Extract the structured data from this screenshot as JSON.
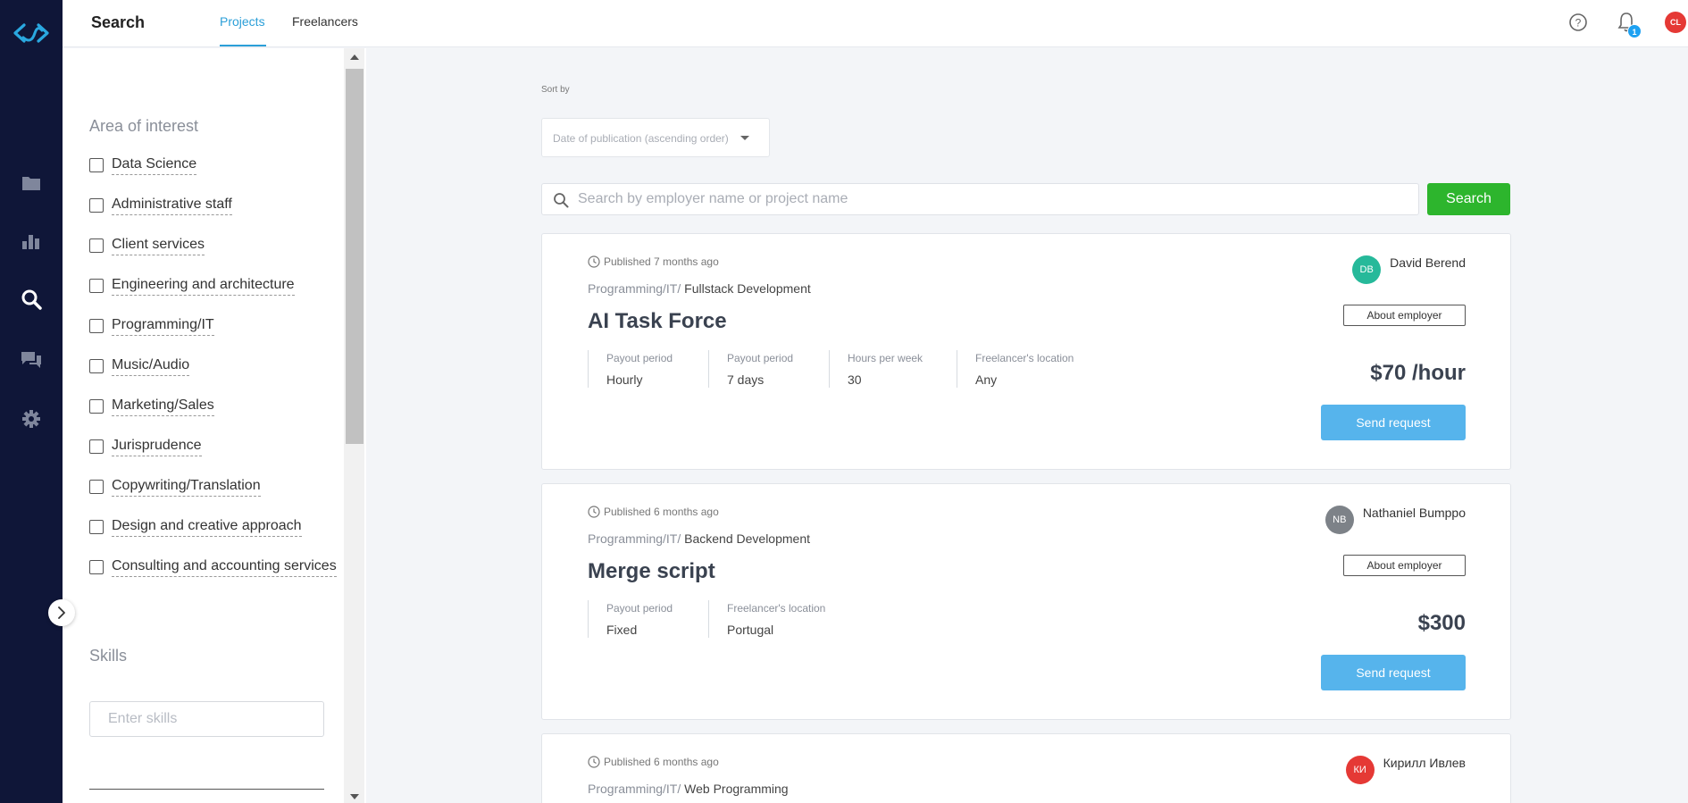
{
  "colors": {
    "rail_bg": "#0f1638",
    "accent": "#2b9fd8",
    "search_button": "#2db52d",
    "send_button": "#56b4ec",
    "notification_badge": "#1da1f2",
    "user_avatar": "#e53935"
  },
  "rail": {
    "logo": "brand-logo-icon",
    "items": [
      {
        "icon": "folder-icon"
      },
      {
        "icon": "bar-chart-icon"
      },
      {
        "icon": "search-icon"
      },
      {
        "icon": "chat-icon"
      },
      {
        "icon": "gear-icon"
      }
    ]
  },
  "header": {
    "title": "Search",
    "tabs": [
      {
        "label": "Projects",
        "active": true
      },
      {
        "label": "Freelancers",
        "active": false
      }
    ],
    "help_icon": "help-circle-icon",
    "bell_icon": "bell-icon",
    "notification_count": "1",
    "user_initials": "CL"
  },
  "filters": {
    "area_title": "Area of interest",
    "areas": [
      "Data Science",
      "Administrative staff",
      "Client services",
      "Engineering and architecture",
      "Programming/IT",
      "Music/Audio",
      "Marketing/Sales",
      "Jurisprudence",
      "Copywriting/Translation",
      "Design and creative approach",
      "Consulting and accounting services"
    ],
    "skills_title": "Skills",
    "skills_placeholder": "Enter skills"
  },
  "sort": {
    "label": "Sort by",
    "value": "Date of publication (ascending order)"
  },
  "search": {
    "placeholder": "Search by employer name or project name",
    "button_label": "Search"
  },
  "projects": [
    {
      "published": "Published 7 months ago",
      "category": "Programming/IT/",
      "subcategory": "Fullstack Development",
      "title": "AI Task Force",
      "props": [
        {
          "label": "Payout period",
          "value": "Hourly"
        },
        {
          "label": "Payout period",
          "value": "7 days"
        },
        {
          "label": "Hours per week",
          "value": "30"
        },
        {
          "label": "Freelancer's location",
          "value": "Any"
        }
      ],
      "employer_initials": "DB",
      "employer_name": "David Berend",
      "employer_color": "#26b99a",
      "about_label": "About employer",
      "price": "$70 /hour",
      "send_label": "Send request"
    },
    {
      "published": "Published 6 months ago",
      "category": "Programming/IT/",
      "subcategory": "Backend Development",
      "title": "Merge script",
      "props": [
        {
          "label": "Payout period",
          "value": "Fixed"
        },
        {
          "label": "Freelancer's location",
          "value": "Portugal"
        }
      ],
      "employer_initials": "NB",
      "employer_name": "Nathaniel Bumppo",
      "employer_color": "#7d8288",
      "about_label": "About employer",
      "price": "$300",
      "send_label": "Send request"
    },
    {
      "published": "Published 6 months ago",
      "category": "Programming/IT/",
      "subcategory": "Web Programming",
      "title": "",
      "props": [],
      "employer_initials": "КИ",
      "employer_name": "Кирилл Ивлев",
      "employer_color": "#e53935",
      "about_label": "",
      "price": "",
      "send_label": ""
    }
  ]
}
